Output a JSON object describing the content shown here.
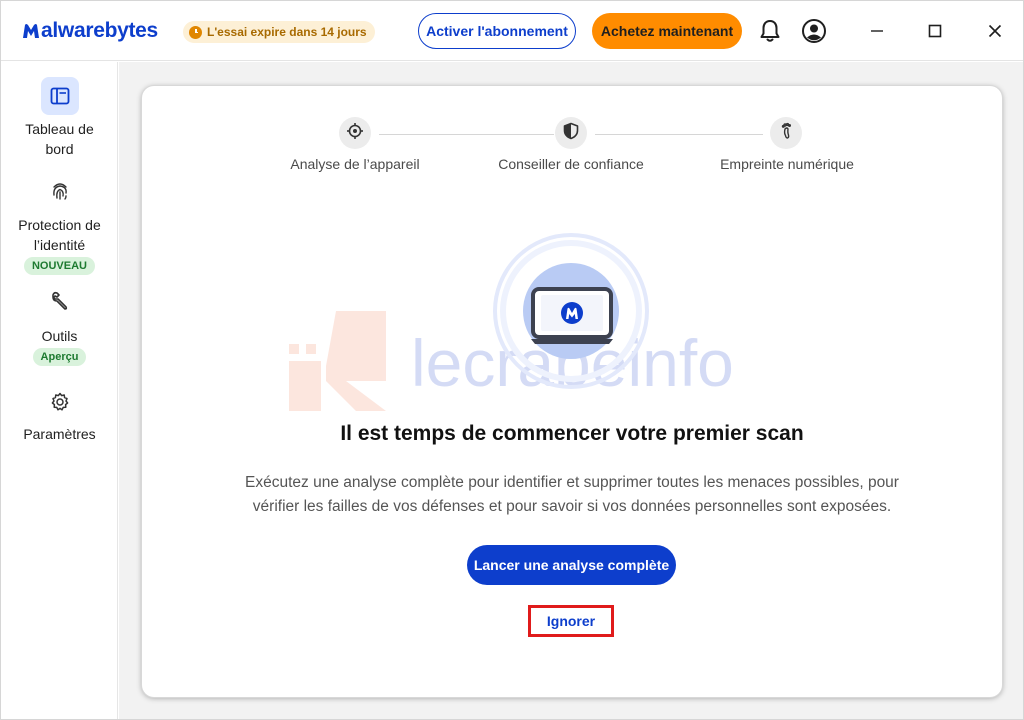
{
  "app": {
    "logo_bold": "alwarebytes",
    "logo_light": "",
    "logo_full": "Malwarebytes",
    "trial_badge": "L'essai expire dans 14 jours",
    "subscribe_button": "Activer l'abonnement",
    "buy_button": "Achetez maintenant",
    "icons": [
      "clock-icon",
      "bell-icon",
      "user-account-icon",
      "minimize-icon",
      "maximize-icon",
      "close-icon"
    ]
  },
  "colors": {
    "brand_blue": "#0d3ecc",
    "orange": "#ff8c00",
    "badge_green_bg": "#d9f2dc",
    "badge_green_text": "#1d7a30",
    "highlight_red": "#e01b1b"
  },
  "sidebar": {
    "items": [
      {
        "label": "Tableau de\nbord",
        "icon": "dashboard-icon",
        "active": true,
        "badge": ""
      },
      {
        "label": "Protection de\nl’identité",
        "icon": "fingerprint-icon",
        "active": false,
        "badge": "NOUVEAU"
      },
      {
        "label": "Outils",
        "icon": "wrench-icon",
        "active": false,
        "badge": "Aperçu"
      },
      {
        "label": "Paramètres",
        "icon": "gear-icon",
        "active": false,
        "badge": ""
      }
    ]
  },
  "stepper": {
    "steps": [
      {
        "label": "Analyse de l’appareil",
        "icon": "crosshair-icon"
      },
      {
        "label": "Conseiller de confiance",
        "icon": "shield-icon"
      },
      {
        "label": "Empreinte numérique",
        "icon": "footprint-icon"
      }
    ]
  },
  "watermark": "lecrabeinfo",
  "main": {
    "headline": "Il est temps de commencer votre premier scan",
    "description": "Exécutez une analyse complète pour identifier et supprimer toutes les menaces possibles, pour vérifier les failles de vos défenses et pour savoir si vos données personnelles sont exposées.",
    "scan_button": "Lancer une analyse complète",
    "ignore_button": "Ignorer"
  }
}
